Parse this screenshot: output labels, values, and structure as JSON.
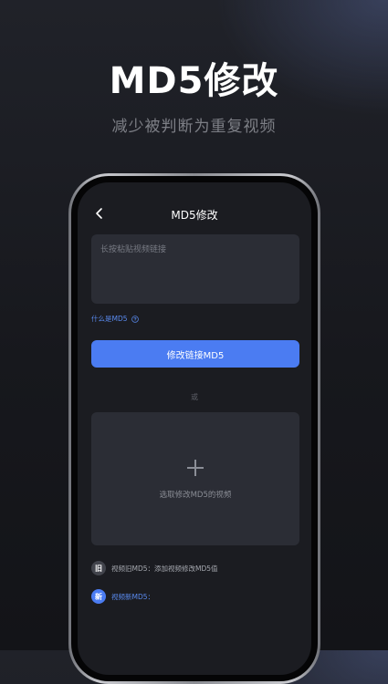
{
  "hero": {
    "title": "MD5修改",
    "subtitle": "减少被判断为重复视频"
  },
  "screen": {
    "title": "MD5修改",
    "back_icon": "chevron-left-icon",
    "link_input": {
      "placeholder": "长按粘贴视频链接",
      "value": ""
    },
    "what_md5_label": "什么是MD5",
    "help_icon": "question-circle-icon",
    "modify_button_label": "修改链接MD5",
    "or_label": "或",
    "upload": {
      "icon": "plus-icon",
      "label": "选取修改MD5的视频"
    },
    "old_md5": {
      "badge": "旧",
      "label": "视频旧MD5：添加视频修改MD5值"
    },
    "new_md5": {
      "badge": "新",
      "label": "视频新MD5："
    }
  },
  "colors": {
    "accent": "#4b7cf2",
    "link": "#5a8bf0",
    "background": "#17181d",
    "card": "#2b2d35"
  }
}
